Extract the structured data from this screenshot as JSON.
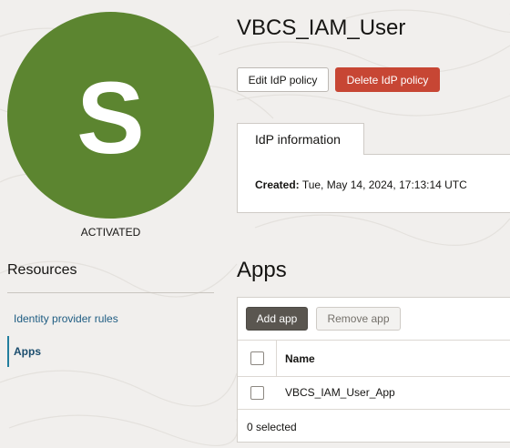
{
  "colors": {
    "avatar_bg": "#5c8530",
    "delete_bg": "#c74634",
    "add_bg": "#5a5650",
    "link": "#1e5c82"
  },
  "user": {
    "initial": "S",
    "name": "VBCS_IAM_User",
    "status": "ACTIVATED"
  },
  "actions": {
    "edit_label": "Edit IdP policy",
    "delete_label": "Delete IdP policy"
  },
  "info": {
    "tab_label": "IdP information",
    "created_label": "Created:",
    "created_value": "Tue, May 14, 2024, 17:13:14 UTC"
  },
  "resources": {
    "title": "Resources",
    "items": [
      {
        "label": "Identity provider rules",
        "active": false
      },
      {
        "label": "Apps",
        "active": true
      }
    ]
  },
  "apps": {
    "title": "Apps",
    "add_label": "Add app",
    "remove_label": "Remove app",
    "columns": [
      "Name"
    ],
    "rows": [
      {
        "name": "VBCS_IAM_User_App"
      }
    ],
    "selected_text": "0 selected"
  }
}
